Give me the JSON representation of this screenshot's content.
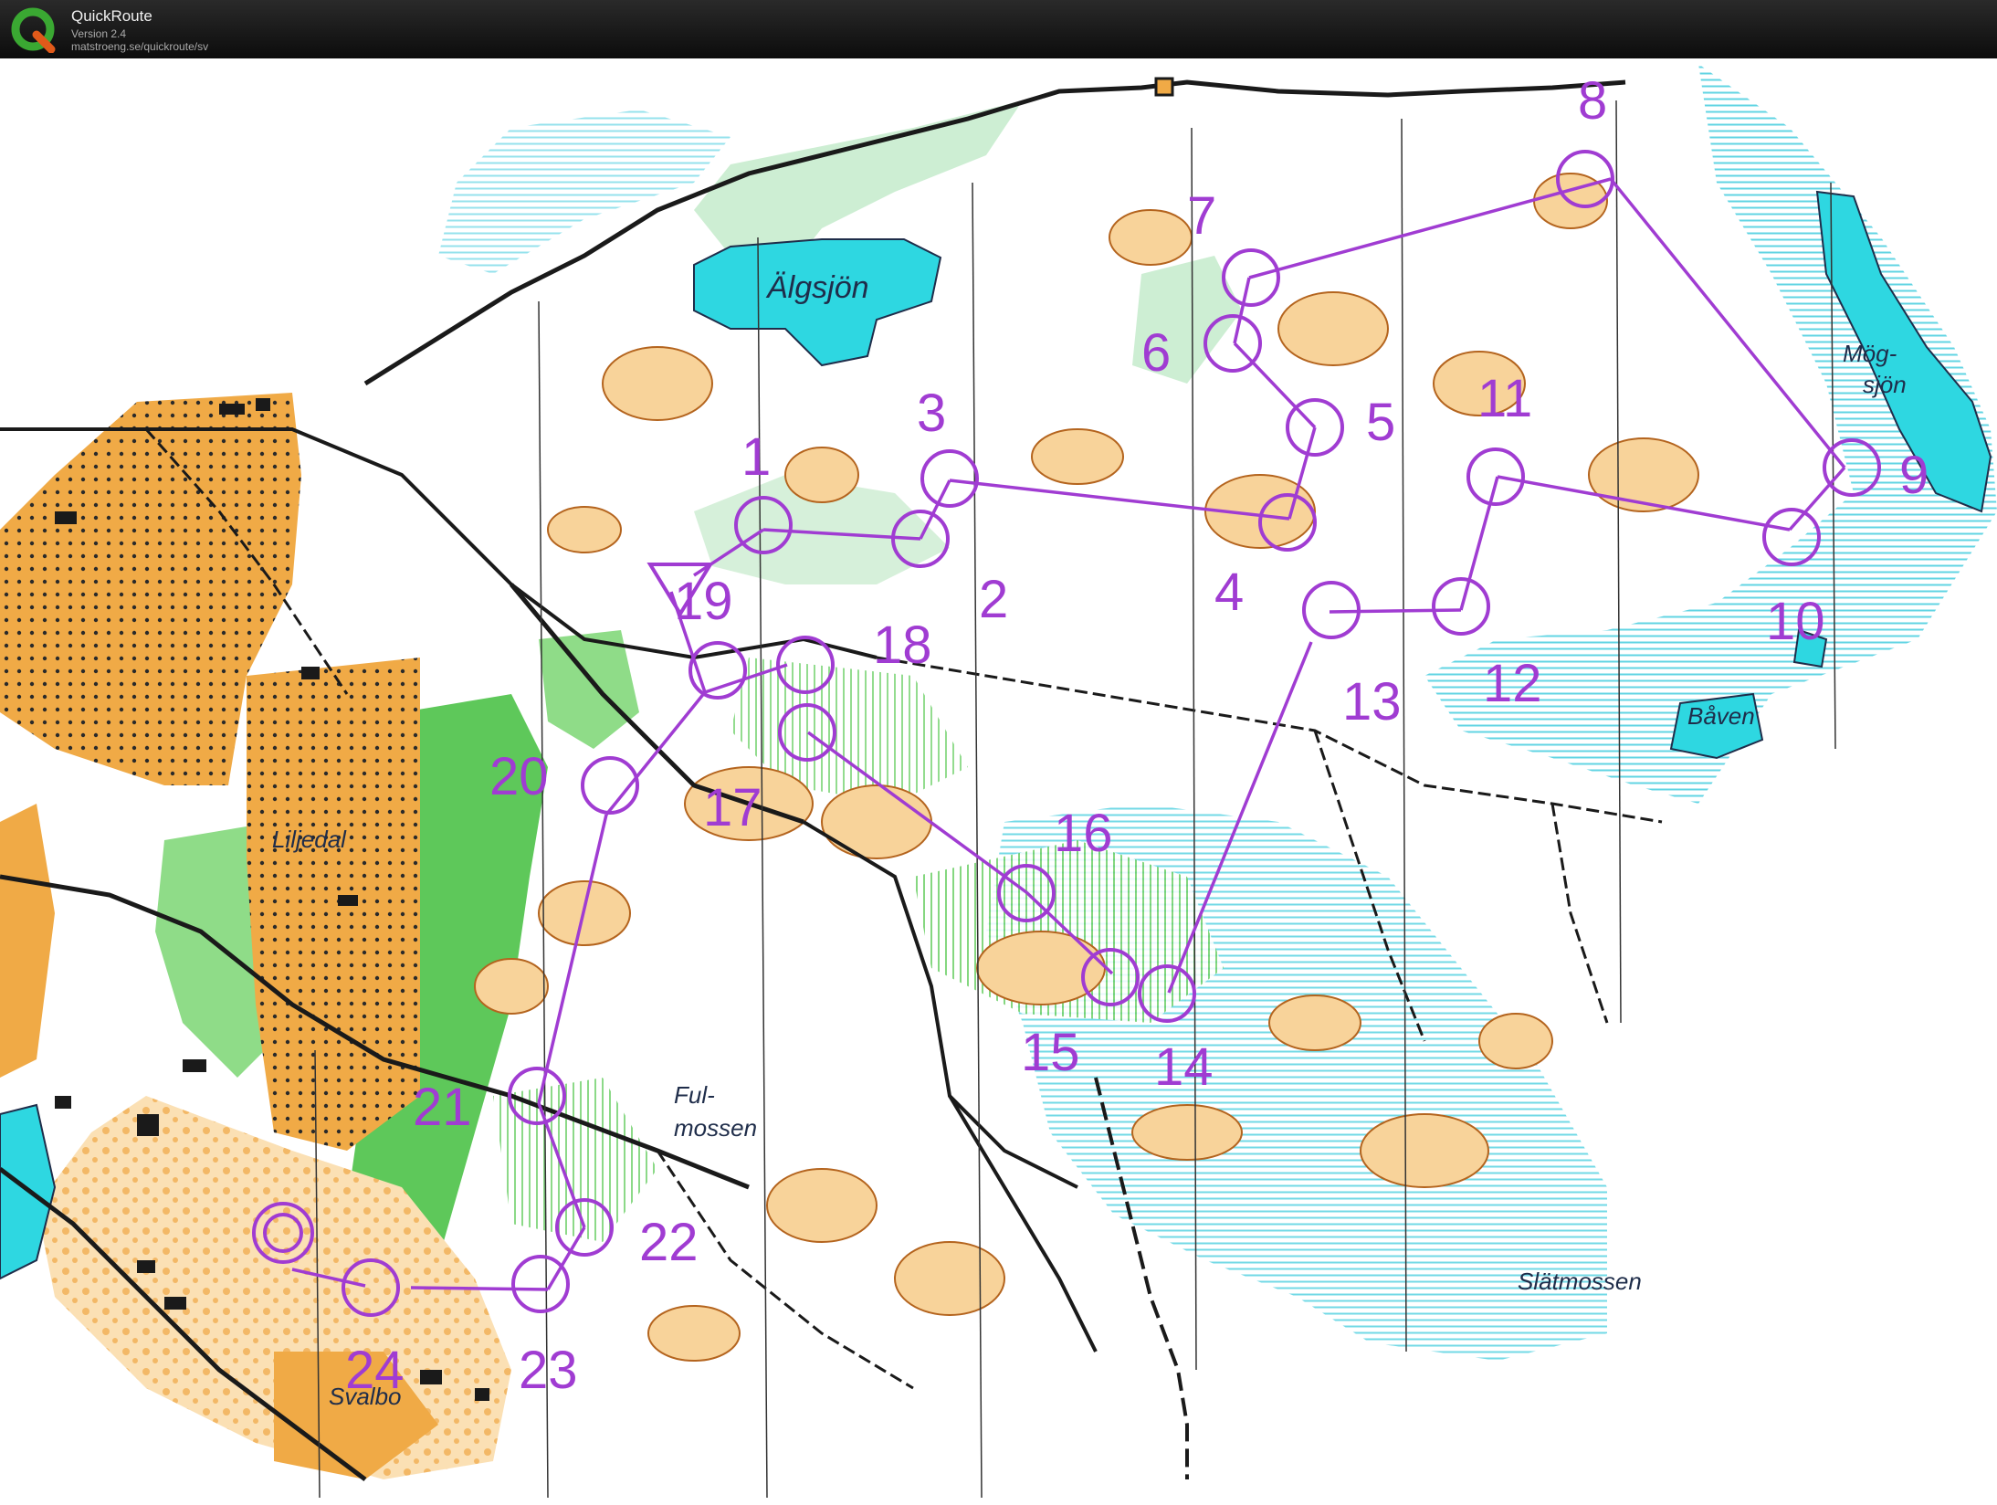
{
  "app": {
    "title": "QuickRoute",
    "version": "Version 2.4",
    "url": "matstroeng.se/quickroute/sv",
    "logo_icon": "quickroute-q-logo-icon"
  },
  "colors": {
    "course_purple": "#a03cd2",
    "water_blue": "#2ed7e1",
    "open_yellow": "#f0aa46",
    "forest_green": "#5ec85a",
    "marsh_cyan": "#60d8e6",
    "contour_brown": "#b4641e"
  },
  "map": {
    "place_names": {
      "algsjon": "Älgsjön",
      "mogsjon_1": "Mög-",
      "mogsjon_2": "sjön",
      "baven": "Båven",
      "liljedal": "Liljedal",
      "fulmossen_1": "Ful-",
      "fulmossen_2": "mossen",
      "slatmossen": "Slätmossen",
      "svalbo": "Svalbo"
    }
  },
  "course": {
    "start_label": "start-triangle",
    "finish_label": "finish-double-circle",
    "controls": [
      {
        "id": "c1",
        "number": "1"
      },
      {
        "id": "c2",
        "number": "2"
      },
      {
        "id": "c3",
        "number": "3"
      },
      {
        "id": "c4",
        "number": "4"
      },
      {
        "id": "c5",
        "number": "5"
      },
      {
        "id": "c6",
        "number": "6"
      },
      {
        "id": "c7",
        "number": "7"
      },
      {
        "id": "c8",
        "number": "8"
      },
      {
        "id": "c9",
        "number": "9"
      },
      {
        "id": "c10",
        "number": "10"
      },
      {
        "id": "c11",
        "number": "11"
      },
      {
        "id": "c12",
        "number": "12"
      },
      {
        "id": "c13",
        "number": "13"
      },
      {
        "id": "c14",
        "number": "14"
      },
      {
        "id": "c15",
        "number": "15"
      },
      {
        "id": "c16",
        "number": "16"
      },
      {
        "id": "c17",
        "number": "17"
      },
      {
        "id": "c18",
        "number": "18"
      },
      {
        "id": "c19",
        "number": "19"
      },
      {
        "id": "c20",
        "number": "20"
      },
      {
        "id": "c21",
        "number": "21"
      },
      {
        "id": "c22",
        "number": "22"
      },
      {
        "id": "c23",
        "number": "23"
      },
      {
        "id": "c24",
        "number": "24"
      }
    ]
  }
}
